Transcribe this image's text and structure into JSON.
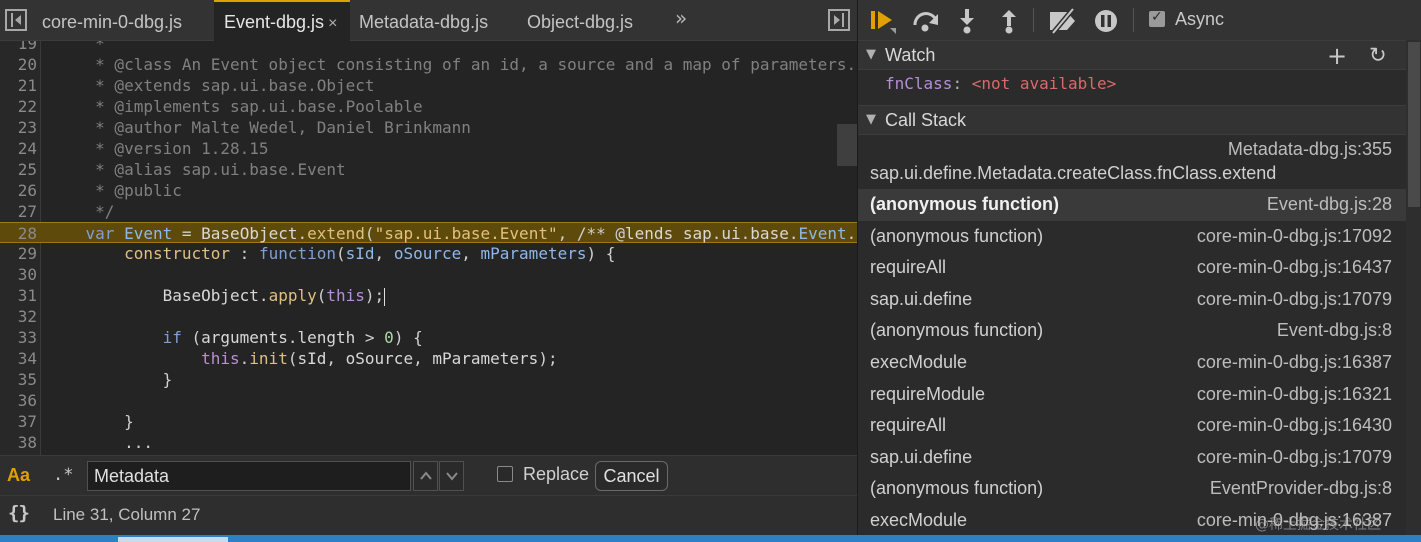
{
  "tabs": [
    {
      "label": "core-min-0-dbg.js",
      "active": false,
      "closable": false
    },
    {
      "label": "Event-dbg.js",
      "active": true,
      "closable": true
    },
    {
      "label": "Metadata-dbg.js",
      "active": false,
      "closable": false
    },
    {
      "label": "Object-dbg.js",
      "active": false,
      "closable": false
    }
  ],
  "tab_more": "»",
  "tab_close": "×",
  "code": {
    "lines": [
      {
        "n": "19",
        "text": "     *"
      },
      {
        "n": "20",
        "text": "     * @class An Event object consisting of an id, a source and a map of parameters."
      },
      {
        "n": "21",
        "text": "     * @extends sap.ui.base.Object"
      },
      {
        "n": "22",
        "text": "     * @implements sap.ui.base.Poolable"
      },
      {
        "n": "23",
        "text": "     * @author Malte Wedel, Daniel Brinkmann"
      },
      {
        "n": "24",
        "text": "     * @version 1.28.15"
      },
      {
        "n": "25",
        "text": "     * @alias sap.ui.base.Event"
      },
      {
        "n": "26",
        "text": "     * @public"
      },
      {
        "n": "27",
        "text": "     */"
      },
      {
        "n": "28",
        "text": "    var Event = BaseObject.extend(\"sap.ui.base.Event\", /** @lends sap.ui.base.Event.prototype */ {"
      },
      {
        "n": "29",
        "text": "        constructor : function(sId, oSource, mParameters) {"
      },
      {
        "n": "30",
        "text": ""
      },
      {
        "n": "31",
        "text": "            BaseObject.apply(this);"
      },
      {
        "n": "32",
        "text": ""
      },
      {
        "n": "33",
        "text": "            if (arguments.length > 0) {"
      },
      {
        "n": "34",
        "text": "                this.init(sId, oSource, mParameters);"
      },
      {
        "n": "35",
        "text": "            }"
      },
      {
        "n": "36",
        "text": ""
      },
      {
        "n": "37",
        "text": "        }"
      },
      {
        "n": "38",
        "text": "        ..."
      }
    ],
    "highlighted_line": "28",
    "cursor_line": "31"
  },
  "search": {
    "case_label": "Aa",
    "regex_label": ".*",
    "value": "Metadata",
    "replace_label": "Replace",
    "cancel_label": "Cancel"
  },
  "status": {
    "pretty_print": "{}",
    "position": "Line 31, Column 27"
  },
  "debugger": {
    "async_label": "Async",
    "async_checked": true,
    "watch_title": "Watch",
    "watch_name": "fnClass",
    "watch_colon": ":",
    "watch_value": "<not available>",
    "add_symbol": "+",
    "refresh_symbol": "↻",
    "callstack_title": "Call Stack",
    "frames": [
      {
        "fn": "sap.ui.define.Metadata.createClass.fnClass.extend",
        "loc": "Metadata-dbg.js:355",
        "selected": false
      },
      {
        "fn": "(anonymous function)",
        "loc": "Event-dbg.js:28",
        "selected": true
      },
      {
        "fn": "(anonymous function)",
        "loc": "core-min-0-dbg.js:17092",
        "selected": false
      },
      {
        "fn": "requireAll",
        "loc": "core-min-0-dbg.js:16437",
        "selected": false
      },
      {
        "fn": "sap.ui.define",
        "loc": "core-min-0-dbg.js:17079",
        "selected": false
      },
      {
        "fn": "(anonymous function)",
        "loc": "Event-dbg.js:8",
        "selected": false
      },
      {
        "fn": "execModule",
        "loc": "core-min-0-dbg.js:16387",
        "selected": false
      },
      {
        "fn": "requireModule",
        "loc": "core-min-0-dbg.js:16321",
        "selected": false
      },
      {
        "fn": "requireAll",
        "loc": "core-min-0-dbg.js:16430",
        "selected": false
      },
      {
        "fn": "sap.ui.define",
        "loc": "core-min-0-dbg.js:17079",
        "selected": false
      },
      {
        "fn": "(anonymous function)",
        "loc": "EventProvider-dbg.js:8",
        "selected": false
      },
      {
        "fn": "execModule",
        "loc": "core-min-0-dbg.js:16387",
        "selected": false
      }
    ]
  },
  "watermark": "@稀土掘金技术社区",
  "colors": {
    "accent": "#e0a000",
    "highlight_line": "#5e4b0c",
    "watch_value": "#d96a6a",
    "watch_name": "#b58fd6"
  }
}
